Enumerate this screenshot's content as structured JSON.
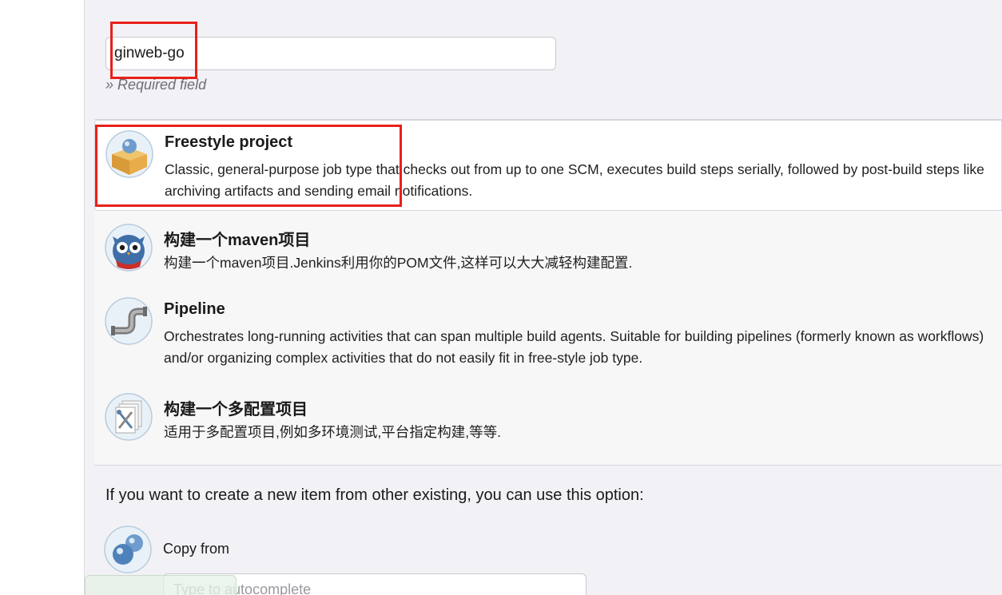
{
  "form": {
    "item_name_value": "ginweb-go",
    "required_hint": "» Required field"
  },
  "item_types": [
    {
      "title": "Freestyle project",
      "description": "Classic, general-purpose job type that checks out from up to one SCM, executes build steps serially, followed by post-build steps like archiving artifacts and sending email notifications.",
      "icon": "package-box-icon",
      "selected": true
    },
    {
      "title": "构建一个maven项目",
      "description": "构建一个maven项目.Jenkins利用你的POM文件,这样可以大大减轻构建配置.",
      "icon": "maven-owl-icon",
      "selected": false
    },
    {
      "title": "Pipeline",
      "description": "Orchestrates long-running activities that can span multiple build agents. Suitable for building pipelines (formerly known as workflows) and/or organizing complex activities that do not easily fit in free-style job type.",
      "icon": "pipe-icon",
      "selected": false
    },
    {
      "title": "构建一个多配置项目",
      "description": "适用于多配置项目,例如多环境测试,平台指定构建,等等.",
      "icon": "multi-config-tools-icon",
      "selected": false
    }
  ],
  "copy_section": {
    "heading": "If you want to create a new item from other existing, you can use this option:",
    "label": "Copy from",
    "placeholder": "Type to autocomplete",
    "icon": "copy-spheres-icon"
  },
  "colors": {
    "annotation_red": "#e8201a",
    "panel_background": "#f2f2f6",
    "selected_background": "#ffffff"
  }
}
